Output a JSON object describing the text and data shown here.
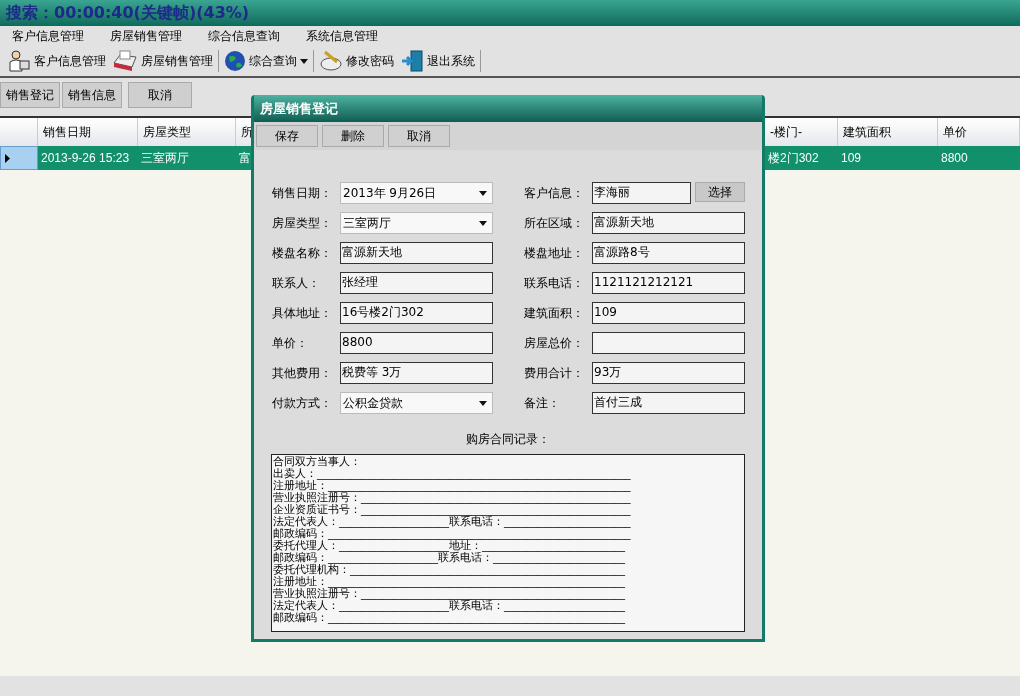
{
  "overlay_caption": "搜索：00:00:40(关键帧)(43%)",
  "menu": [
    "客户信息管理",
    "房屋销售管理",
    "综合信息查询",
    "系统信息管理"
  ],
  "toolbar": [
    {
      "label": "客户信息管理",
      "dropdown": false
    },
    {
      "label": "房屋销售管理",
      "dropdown": false
    },
    {
      "label": "综合查询",
      "dropdown": true
    },
    {
      "label": "修改密码",
      "dropdown": false
    },
    {
      "label": "退出系统",
      "dropdown": false
    }
  ],
  "action_buttons": [
    "销售登记",
    "销售信息",
    "取消"
  ],
  "grid": {
    "columns": [
      "销售日期",
      "房屋类型",
      "所",
      "-楼门-",
      "建筑面积",
      "单价"
    ],
    "rows": [
      {
        "selected": true,
        "cells": [
          "2013-9-26 15:23",
          "三室两厅",
          "富",
          "楼2门302",
          "109",
          "8800"
        ]
      }
    ]
  },
  "dialog": {
    "title": "房屋销售登记",
    "buttons": [
      "保存",
      "删除",
      "取消"
    ],
    "fields": [
      {
        "label": "销售日期：",
        "value": "2013年 9月26日",
        "kind": "dropdown"
      },
      {
        "label": "客户信息：",
        "value": "李海丽",
        "kind": "picker",
        "button": "选择"
      },
      {
        "label": "房屋类型：",
        "value": "三室两厅",
        "kind": "dropdown"
      },
      {
        "label": "所在区域：",
        "value": "富源新天地",
        "kind": "text"
      },
      {
        "label": "楼盘名称：",
        "value": "富源新天地",
        "kind": "text"
      },
      {
        "label": "楼盘地址：",
        "value": "富源路8号",
        "kind": "text"
      },
      {
        "label": "联系人：",
        "value": "张经理",
        "kind": "text"
      },
      {
        "label": "联系电话：",
        "value": "1121121212121",
        "kind": "text"
      },
      {
        "label": "具体地址：",
        "value": "16号楼2门302",
        "kind": "text"
      },
      {
        "label": "建筑面积：",
        "value": "109",
        "kind": "text"
      },
      {
        "label": "单价：",
        "value": "8800",
        "kind": "text"
      },
      {
        "label": "房屋总价：",
        "kind": "text"
      },
      {
        "label": "其他费用：",
        "value": "税费等 3万",
        "kind": "text"
      },
      {
        "label": "费用合计：",
        "value": "93万",
        "kind": "text"
      },
      {
        "label": "付款方式：",
        "value": "公积金贷款",
        "kind": "dropdown"
      },
      {
        "label": "备注：",
        "value": "首付三成",
        "kind": "text"
      }
    ],
    "contract_label": "购房合同记录：",
    "contract_lines": [
      "合同双方当事人：",
      "出卖人：_________________________________________________________",
      "注册地址：_______________________________________________________",
      "营业执照注册号：_________________________________________________",
      "企业资质证书号：_________________________________________________",
      "法定代表人：____________________联系电话：_______________________",
      "邮政编码：_______________________________________________________",
      "委托代理人：____________________地址：__________________________",
      "邮政编码：____________________联系电话：________________________",
      "委托代理机构：__________________________________________________",
      "注册地址：______________________________________________________",
      "营业执照注册号：________________________________________________",
      "法定代表人：____________________联系电话：______________________",
      "邮政编码：______________________________________________________"
    ]
  }
}
